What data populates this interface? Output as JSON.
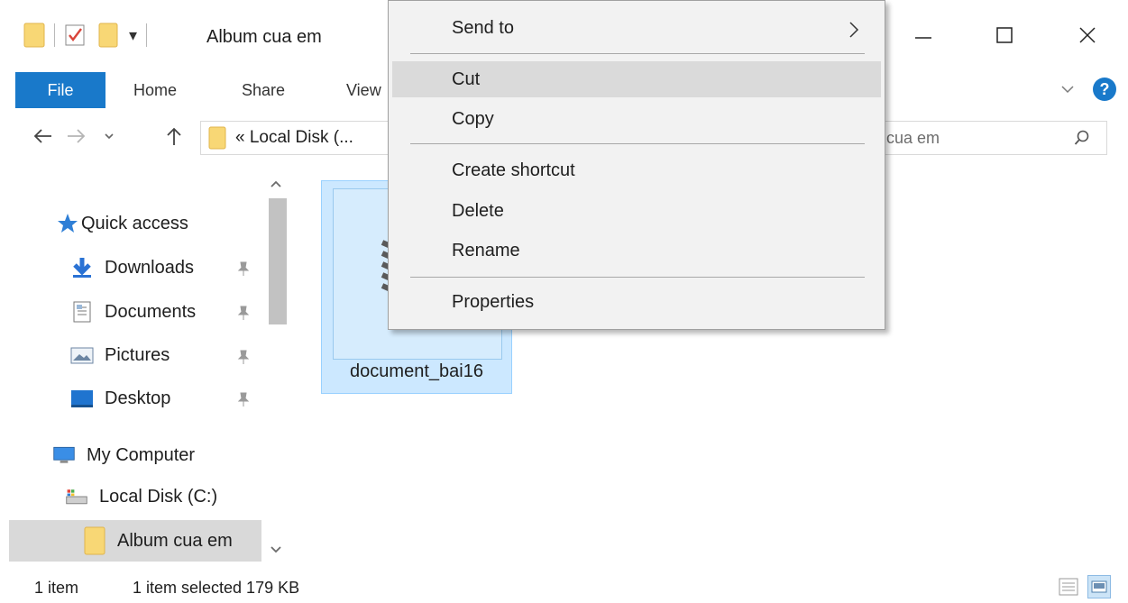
{
  "window": {
    "title": "Album cua em"
  },
  "ribbon": {
    "tabs": [
      {
        "label": "File"
      },
      {
        "label": "Home"
      },
      {
        "label": "Share"
      },
      {
        "label": "View"
      }
    ],
    "accent": "#1979ca"
  },
  "address": {
    "path": "« Local Disk (...",
    "search_visible": "cua em"
  },
  "nav_pane": {
    "quick_access": "Quick access",
    "items": [
      {
        "label": "Downloads",
        "icon": "download-arrow-icon",
        "pinned": true
      },
      {
        "label": "Documents",
        "icon": "documents-icon",
        "pinned": true
      },
      {
        "label": "Pictures",
        "icon": "pictures-icon",
        "pinned": true
      },
      {
        "label": "Desktop",
        "icon": "desktop-icon",
        "pinned": true
      }
    ],
    "my_computer": "My Computer",
    "local_disk": "Local Disk (C:)",
    "current_folder": "Album cua em"
  },
  "content": {
    "files": [
      {
        "name": "document_bai16",
        "selected": true
      }
    ],
    "selection_color": "#cce8ff"
  },
  "context_menu": {
    "items": [
      {
        "label": "Send to",
        "has_submenu": true
      },
      {
        "label": "Cut",
        "hovered": true
      },
      {
        "label": "Copy"
      },
      {
        "label": "Create shortcut"
      },
      {
        "label": "Delete"
      },
      {
        "label": "Rename"
      },
      {
        "label": "Properties"
      }
    ]
  },
  "status": {
    "item_count": "1 item",
    "selection": "1 item selected  179 KB"
  }
}
